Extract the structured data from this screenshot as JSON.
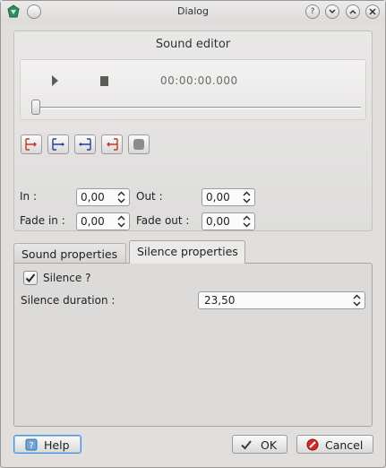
{
  "window": {
    "title": "Dialog"
  },
  "editor": {
    "title": "Sound editor",
    "time_display": "00:00:00.000",
    "position_fraction": 0.0
  },
  "fields": {
    "in_label": "In :",
    "in_value": "0,00",
    "out_label": "Out :",
    "out_value": "0,00",
    "fade_in_label": "Fade in :",
    "fade_in_value": "0,00",
    "fade_out_label": "Fade out :",
    "fade_out_value": "0,00"
  },
  "tabs": [
    {
      "label": "Sound properties",
      "active": false
    },
    {
      "label": "Silence properties",
      "active": true
    }
  ],
  "silence": {
    "checkbox_label": "Silence ?",
    "checked": true,
    "duration_label": "Silence duration :",
    "duration_value": "23,50"
  },
  "buttons": {
    "help": "Help",
    "ok": "OK",
    "cancel": "Cancel"
  },
  "icons": {
    "titlebar": [
      "app-icon",
      "help-icon",
      "minimize-icon",
      "maximize-icon",
      "close-icon"
    ],
    "player": [
      "play-icon",
      "stop-icon"
    ],
    "markers": [
      "set-in-icon",
      "set-fade-in-icon",
      "set-fade-out-icon",
      "set-out-icon",
      "record-icon"
    ]
  }
}
